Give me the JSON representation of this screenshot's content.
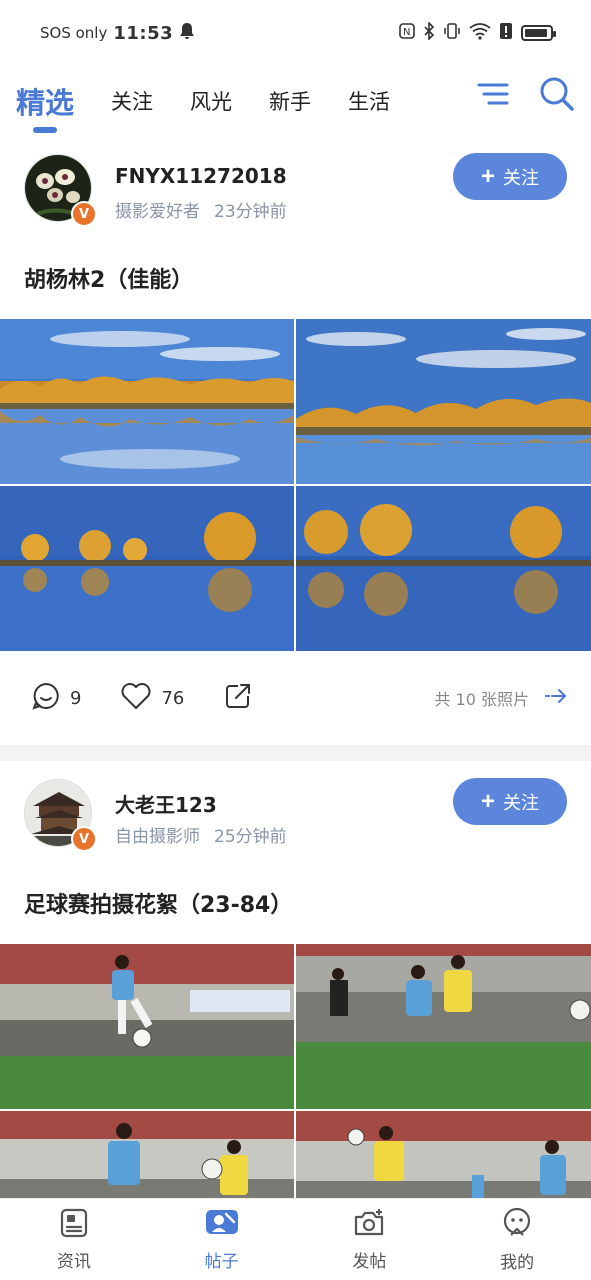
{
  "status_bar": {
    "carrier": "SOS only",
    "time": "11:53",
    "battery_level": 0.9
  },
  "top_tabs": [
    {
      "label": "精选",
      "active": true
    },
    {
      "label": "关注",
      "active": false
    },
    {
      "label": "风光",
      "active": false
    },
    {
      "label": "新手",
      "active": false
    },
    {
      "label": "生活",
      "active": false
    }
  ],
  "top_icons": [
    "menu-icon",
    "search-icon"
  ],
  "posts": [
    {
      "author": "FNYX11272018",
      "role": "摄影爱好者",
      "time": "23分钟前",
      "badge": "V",
      "follow_label": "关注",
      "title": "胡杨林2（佳能）",
      "comments": "9",
      "likes": "76",
      "photo_count_label": "共 10 张照片"
    },
    {
      "author": "大老王123",
      "role": "自由摄影师",
      "time": "25分钟前",
      "badge": "V",
      "follow_label": "关注",
      "title": "足球赛拍摄花絮（23-84）"
    }
  ],
  "bottom_nav": [
    {
      "label": "资讯",
      "icon": "news-icon",
      "active": false
    },
    {
      "label": "帖子",
      "icon": "posts-icon",
      "active": true
    },
    {
      "label": "发帖",
      "icon": "camera-icon",
      "active": false
    },
    {
      "label": "我的",
      "icon": "profile-icon",
      "active": false
    }
  ],
  "colors": {
    "accent": "#4a7ad6",
    "follow_button": "#5b86dc",
    "badge": "#e8742b",
    "meta_text": "#8a95a8"
  }
}
